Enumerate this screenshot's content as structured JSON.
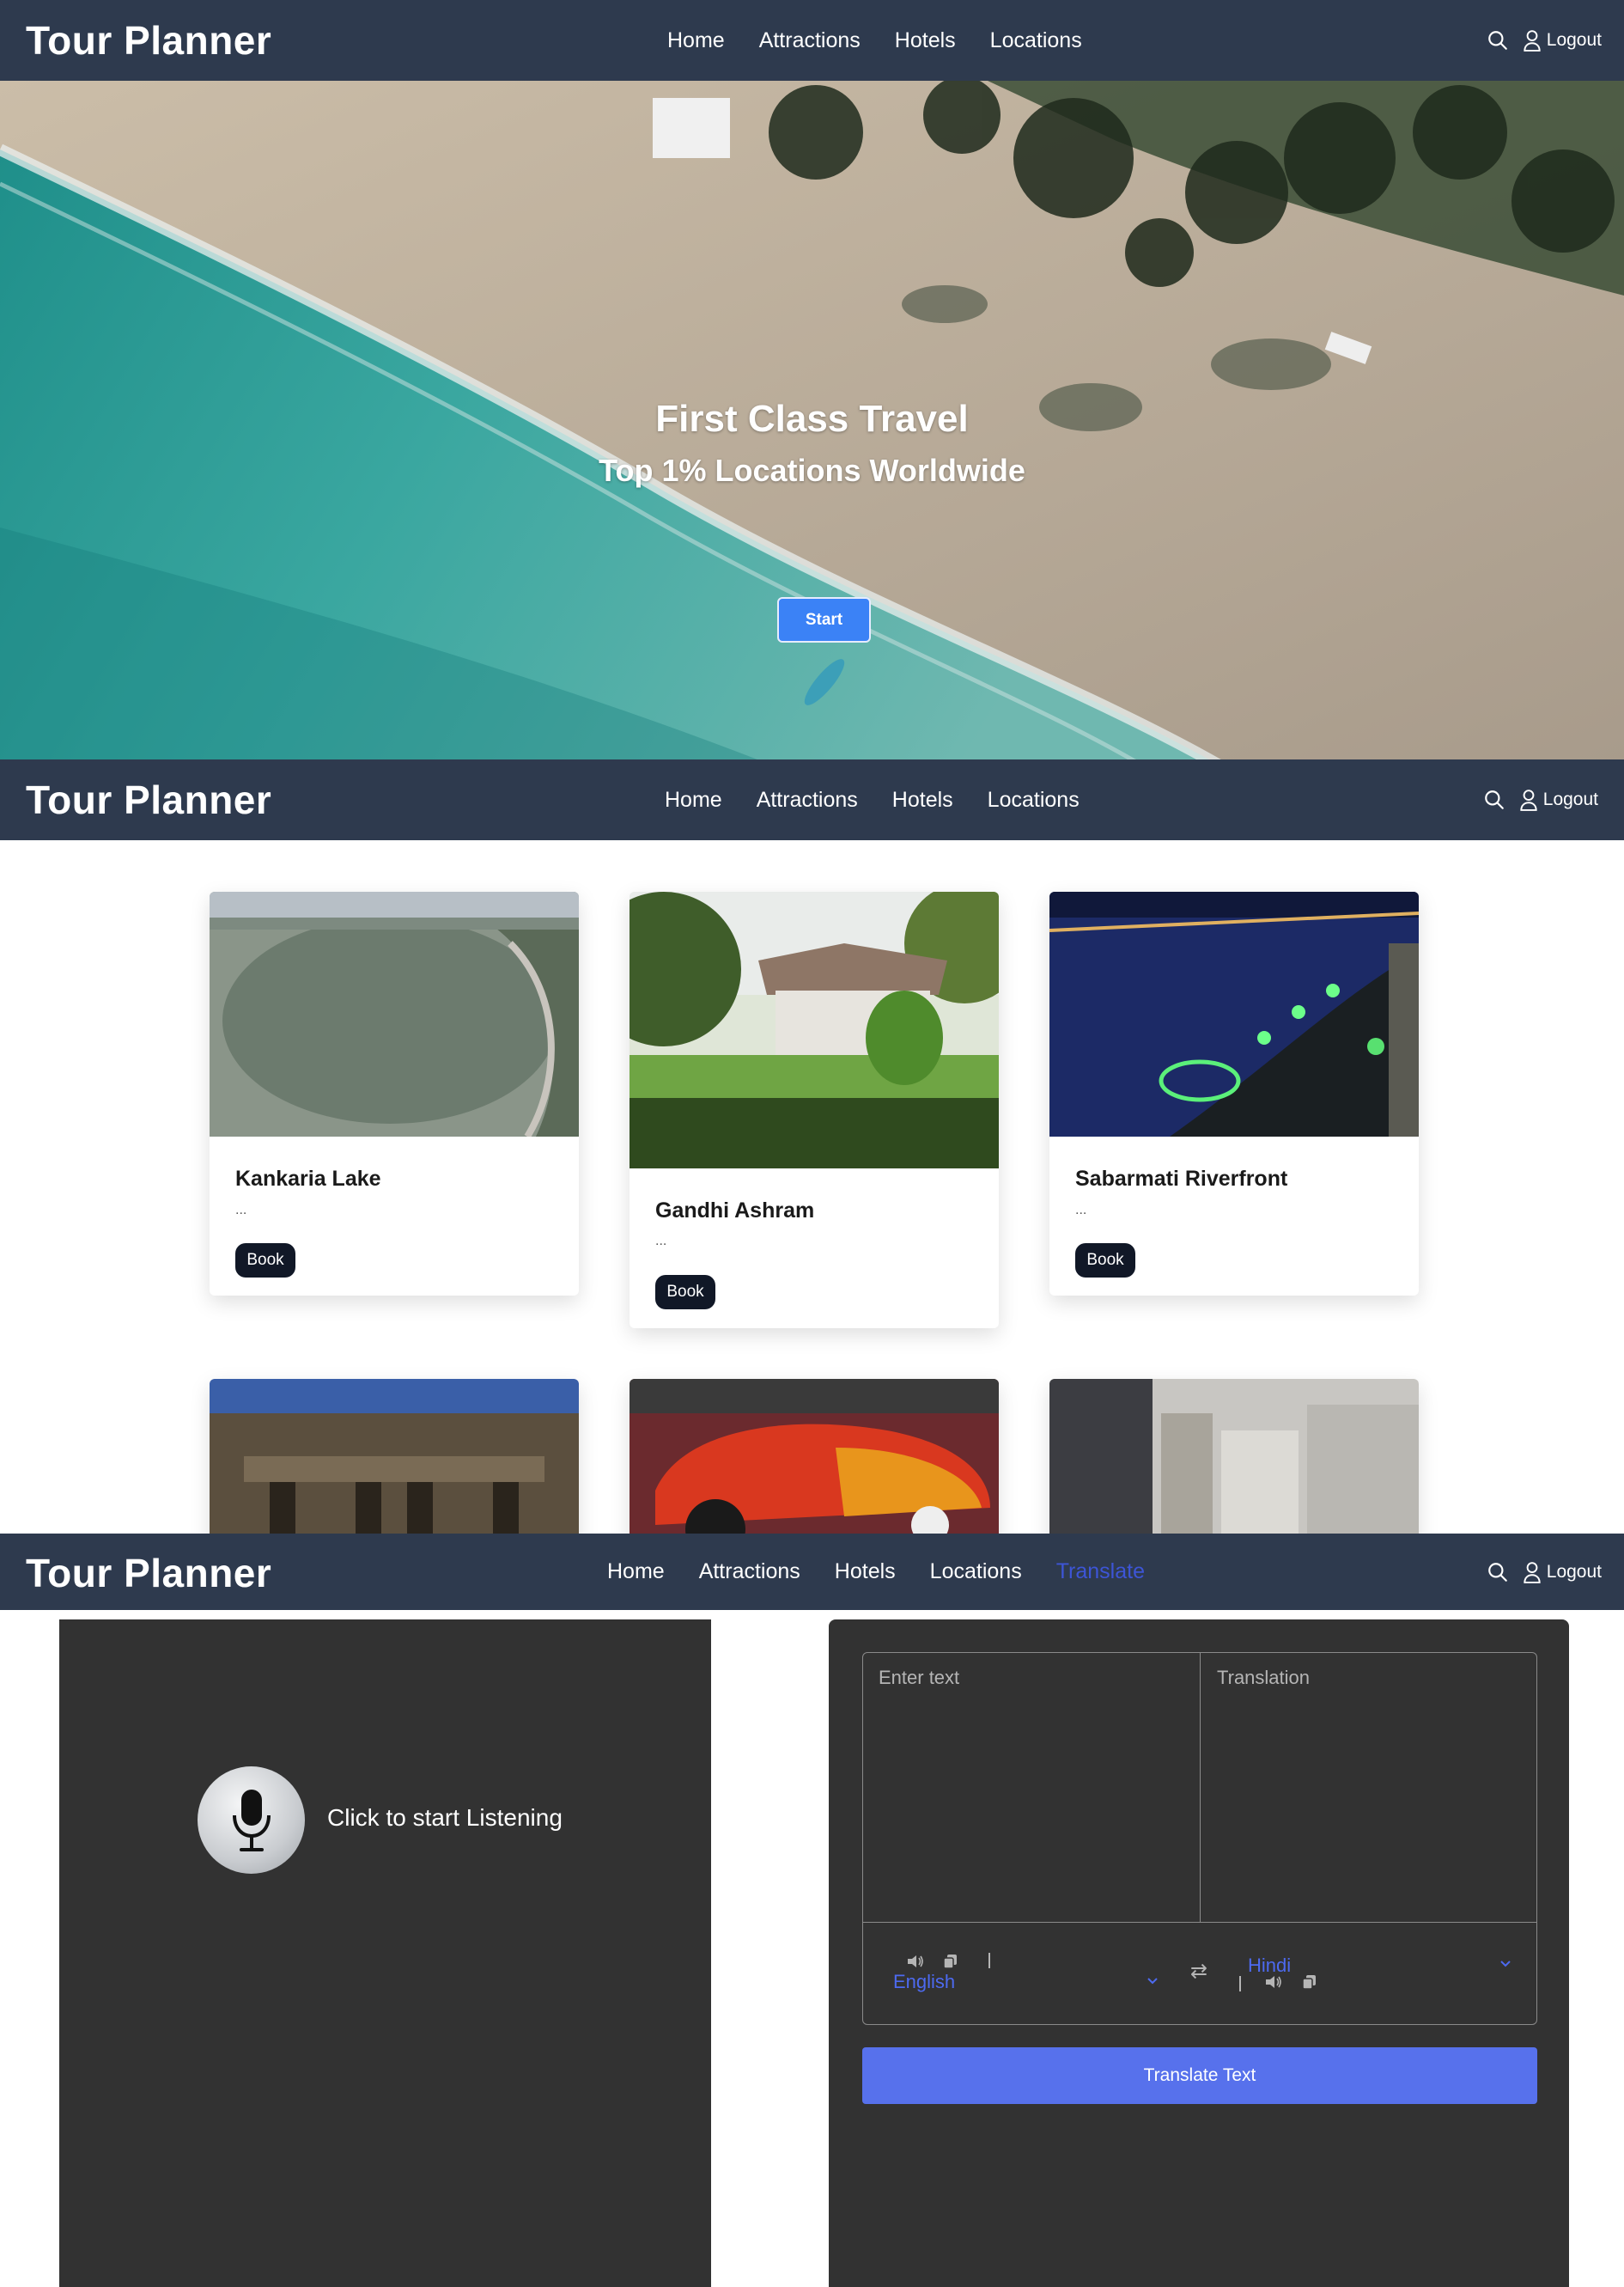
{
  "navbar": {
    "brand": "Tour Planner",
    "links": [
      "Home",
      "Attractions",
      "Hotels",
      "Locations"
    ],
    "extra_link": "Translate",
    "logout": "Logout"
  },
  "hero": {
    "title": "First Class Travel",
    "subtitle": "Top 1% Locations Worldwide",
    "button": "Start"
  },
  "cards": [
    {
      "title": "Kankaria Lake",
      "description": "...",
      "button": "Book"
    },
    {
      "title": "Gandhi Ashram",
      "description": "...",
      "button": "Book"
    },
    {
      "title": "Sabarmati Riverfront",
      "description": "...",
      "button": "Book"
    }
  ],
  "speech": {
    "label": "Click to start Listening"
  },
  "translator": {
    "input_placeholder": "Enter text",
    "output_placeholder": "Translation",
    "source_language": "English",
    "target_language": "Hindi",
    "swap_symbol": "⇄",
    "button": "Translate Text"
  },
  "colors": {
    "navbar": "#2e3a4e",
    "hero_button": "#3b82f6",
    "book_button": "#111827",
    "panel": "#323232",
    "translate_button": "#5771ec",
    "language_text": "#4d6af0"
  }
}
